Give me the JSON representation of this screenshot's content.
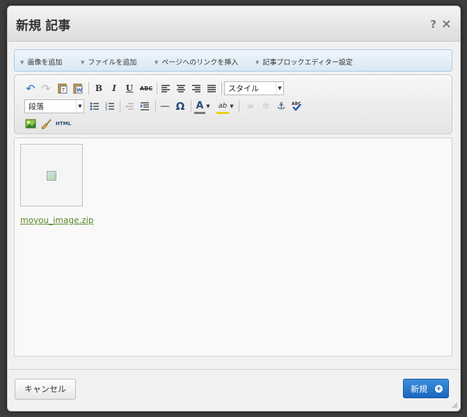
{
  "dialog": {
    "title": "新規 記事",
    "help_glyph": "?",
    "close_glyph": "×"
  },
  "actions": [
    {
      "label": "画像を追加"
    },
    {
      "label": "ファイルを追加"
    },
    {
      "label": "ページへのリンクを挿入"
    },
    {
      "label": "記事ブロックエディター設定"
    }
  ],
  "toolbar": {
    "bold": "B",
    "italic": "I",
    "underline": "U",
    "strike": "ABC",
    "style_select": "スタイル",
    "format_select": "段落",
    "hr": "—",
    "omega": "Ω",
    "text_color": "A",
    "html": "HTML"
  },
  "editor": {
    "attachment_link": "moyou_image.zip"
  },
  "footer": {
    "cancel_label": "キャンセル",
    "new_label": "新規"
  },
  "colors": {
    "primary_button": "#1a66be",
    "link": "#5a8a2a",
    "action_bar": "#d9e8f4"
  }
}
